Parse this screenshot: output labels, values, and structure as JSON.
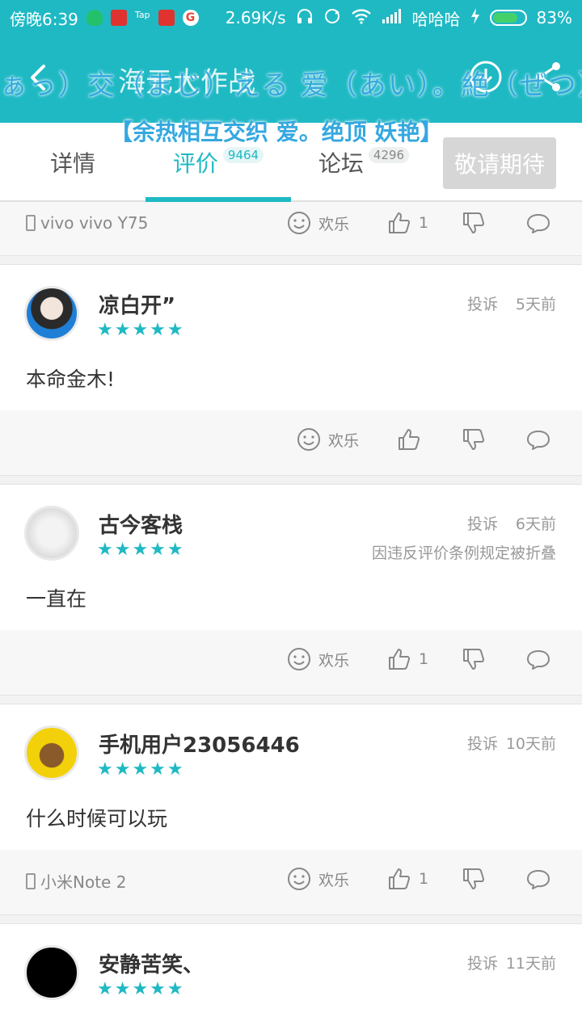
{
  "status_bar": {
    "time": "傍晚6:39",
    "network_speed": "2.69K/s",
    "carrier": "哈哈哈",
    "battery": "83%",
    "battery_level": 0.83
  },
  "header": {
    "title": "海元大作战",
    "overlay_line1": "ぁっ）交（まじ）える 爱（あい）。絶（ぜつ）艶",
    "overlay_line2": "【余热相互交织 爱。绝顶 妖艳】"
  },
  "tabs": [
    {
      "label": "详情",
      "badge": ""
    },
    {
      "label": "评价",
      "badge": "9464"
    },
    {
      "label": "论坛",
      "badge": "4296"
    }
  ],
  "cta_label": "敬请期待",
  "actions_labels": {
    "happy": "欢乐"
  },
  "first_bar": {
    "device": "vivo vivo Y75",
    "likes": "1"
  },
  "reviews": [
    {
      "username": "凉白开”",
      "stars": "★★★★★",
      "complain": "投诉",
      "time": "5天前",
      "content": "本命金木!",
      "device": "",
      "likes": "",
      "folded": ""
    },
    {
      "username": "古今客栈",
      "stars": "★★★★★",
      "complain": "投诉",
      "time": "6天前",
      "content": "一直在",
      "device": "",
      "likes": "1",
      "folded": "因违反评价条例规定被折叠"
    },
    {
      "username": "手机用户23056446",
      "stars": "★★★★★",
      "complain": "投诉",
      "time": "10天前",
      "content": "什么时候可以玩",
      "device": "小米Note 2",
      "likes": "1",
      "folded": ""
    },
    {
      "username": "安静苦笑、",
      "stars": "★★★★★",
      "complain": "投诉",
      "time": "11天前",
      "content": "",
      "device": "",
      "likes": "",
      "folded": ""
    }
  ],
  "colors": {
    "accent": "#1fb9c4",
    "overlay_text": "#35a8e0"
  }
}
